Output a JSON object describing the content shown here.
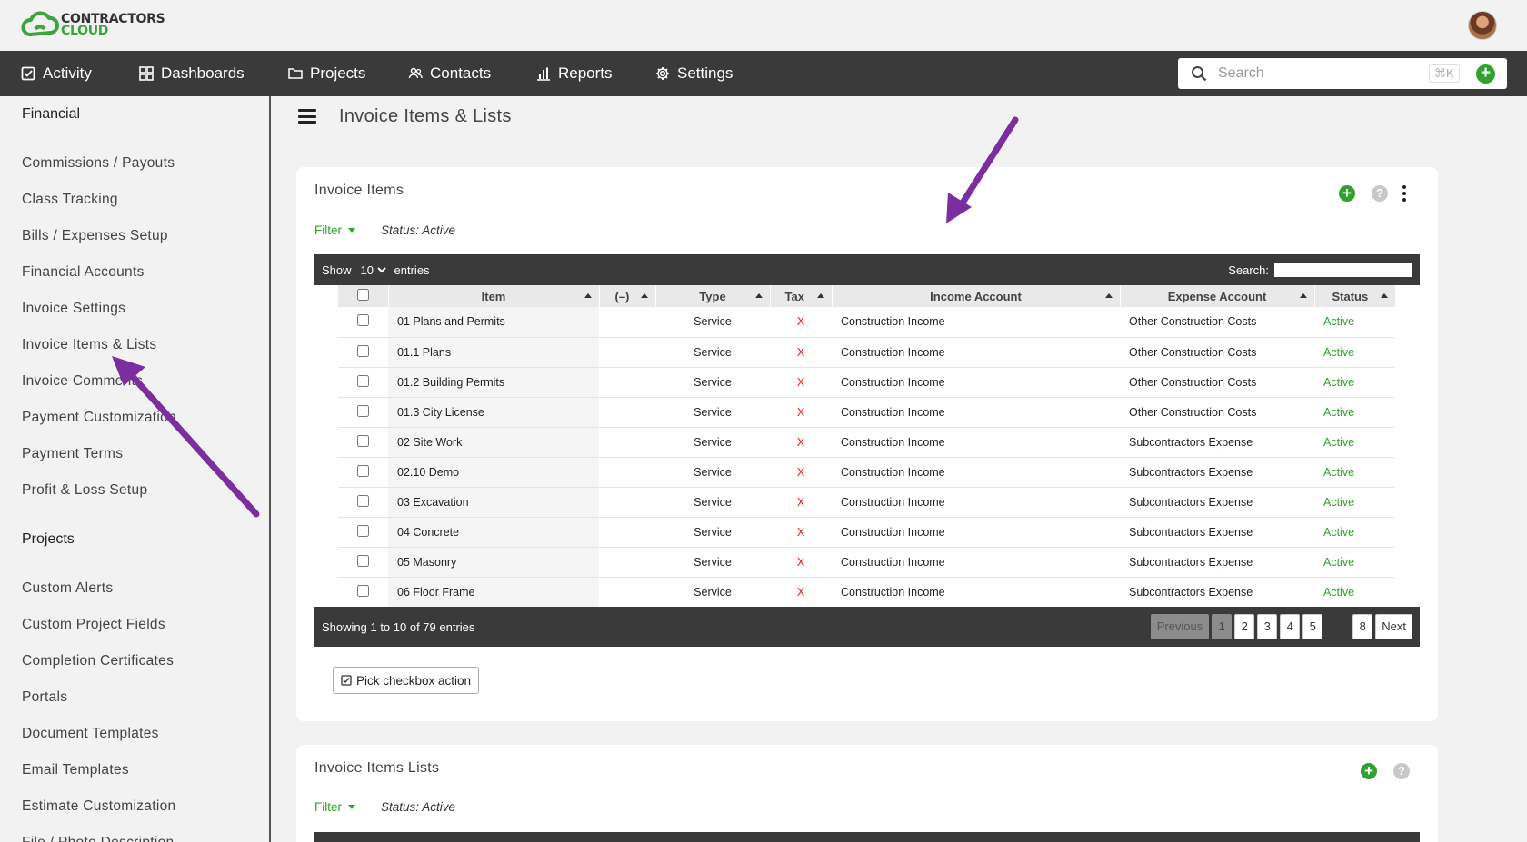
{
  "brand": {
    "line1": "CONTRACTORS",
    "line2": "CLOUD",
    "accent": "#2ea12e",
    "nav_bg": "#3a3a3a"
  },
  "nav": {
    "items": [
      {
        "label": "Activity",
        "icon": "checkbox-icon"
      },
      {
        "label": "Dashboards",
        "icon": "grid-icon"
      },
      {
        "label": "Projects",
        "icon": "folder-icon"
      },
      {
        "label": "Contacts",
        "icon": "people-icon"
      },
      {
        "label": "Reports",
        "icon": "bar-chart-icon"
      },
      {
        "label": "Settings",
        "icon": "gear-icon"
      }
    ],
    "search_placeholder": "Search",
    "shortcut": "⌘K"
  },
  "sidebar": {
    "section1": "Financial",
    "financial_items": [
      "Commissions / Payouts",
      "Class Tracking",
      "Bills / Expenses Setup",
      "Financial Accounts",
      "Invoice Settings",
      "Invoice Items & Lists",
      "Invoice Comments",
      "Payment Customization",
      "Payment Terms",
      "Profit & Loss Setup"
    ],
    "section2": "Projects",
    "project_items": [
      "Custom Alerts",
      "Custom Project Fields",
      "Completion Certificates",
      "Portals",
      "Document Templates",
      "Email Templates",
      "Estimate Customization",
      "File / Photo Description"
    ]
  },
  "page": {
    "title": "Invoice Items & Lists"
  },
  "invoice_items": {
    "title": "Invoice Items",
    "filter_label": "Filter",
    "filter_status": "Status: Active",
    "show_label": "Show",
    "entries_label": "entries",
    "page_length": "10",
    "search_label": "Search:",
    "columns": [
      "Item",
      "(–)",
      "Type",
      "Tax",
      "Income Account",
      "Expense Account",
      "Status"
    ],
    "rows": [
      {
        "item": "01 Plans and Permits",
        "type": "Service",
        "tax": "X",
        "income": "Construction Income",
        "expense": "Other Construction Costs",
        "status": "Active"
      },
      {
        "item": "01.1 Plans",
        "type": "Service",
        "tax": "X",
        "income": "Construction Income",
        "expense": "Other Construction Costs",
        "status": "Active"
      },
      {
        "item": "01.2 Building Permits",
        "type": "Service",
        "tax": "X",
        "income": "Construction Income",
        "expense": "Other Construction Costs",
        "status": "Active"
      },
      {
        "item": "01.3 City License",
        "type": "Service",
        "tax": "X",
        "income": "Construction Income",
        "expense": "Other Construction Costs",
        "status": "Active"
      },
      {
        "item": "02 Site Work",
        "type": "Service",
        "tax": "X",
        "income": "Construction Income",
        "expense": "Subcontractors Expense",
        "status": "Active"
      },
      {
        "item": "02.10 Demo",
        "type": "Service",
        "tax": "X",
        "income": "Construction Income",
        "expense": "Subcontractors Expense",
        "status": "Active"
      },
      {
        "item": "03 Excavation",
        "type": "Service",
        "tax": "X",
        "income": "Construction Income",
        "expense": "Subcontractors Expense",
        "status": "Active"
      },
      {
        "item": "04 Concrete",
        "type": "Service",
        "tax": "X",
        "income": "Construction Income",
        "expense": "Subcontractors Expense",
        "status": "Active"
      },
      {
        "item": "05 Masonry",
        "type": "Service",
        "tax": "X",
        "income": "Construction Income",
        "expense": "Subcontractors Expense",
        "status": "Active"
      },
      {
        "item": "06 Floor Frame",
        "type": "Service",
        "tax": "X",
        "income": "Construction Income",
        "expense": "Subcontractors Expense",
        "status": "Active"
      }
    ],
    "info": "Showing 1 to 10 of 79 entries",
    "pager": {
      "previous": "Previous",
      "pages": [
        "1",
        "2",
        "3",
        "4",
        "5",
        "…",
        "8"
      ],
      "next": "Next"
    },
    "action_button": "Pick checkbox action"
  },
  "invoice_lists": {
    "title": "Invoice Items Lists",
    "filter_label": "Filter",
    "filter_status": "Status: Active"
  }
}
